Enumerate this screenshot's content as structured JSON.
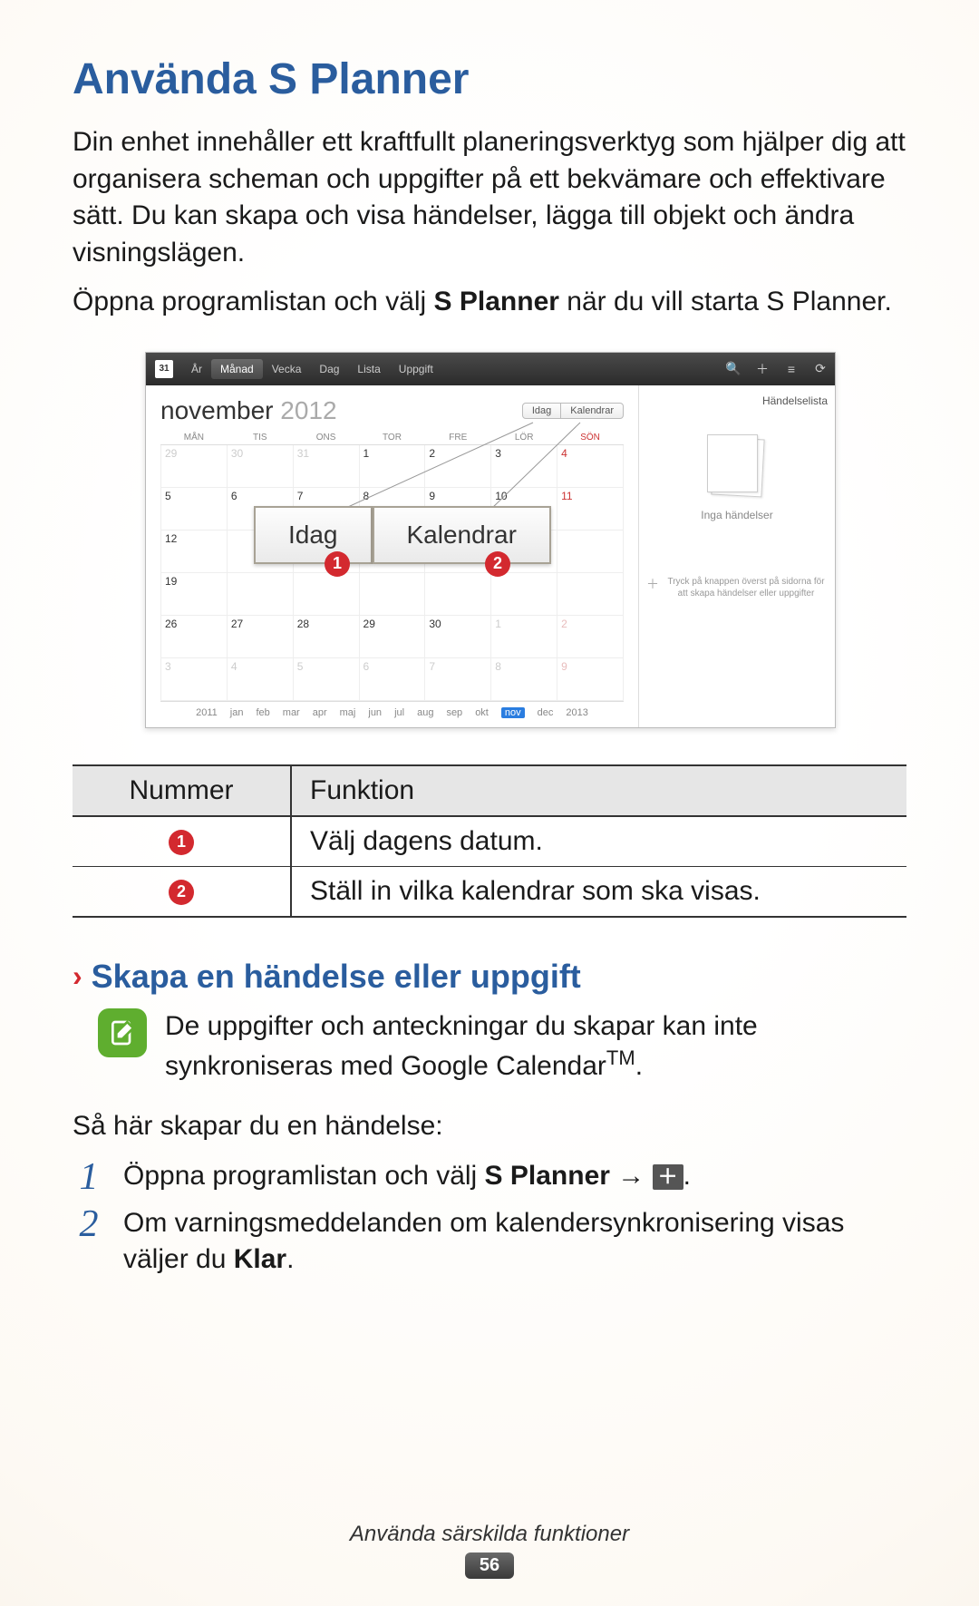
{
  "title": "Använda S Planner",
  "intro1": "Din enhet innehåller ett kraftfullt planeringsverktyg som hjälper dig att organisera scheman och uppgifter på ett bekvämare och effektivare sätt. Du kan skapa och visa händelser, lägga till objekt och ändra visningslägen.",
  "intro2_pre": "Öppna programlistan och välj ",
  "intro2_bold": "S Planner",
  "intro2_post": " när du vill starta S Planner.",
  "screenshot": {
    "badge": "31",
    "tabs": {
      "year": "År",
      "month": "Månad",
      "week": "Vecka",
      "day": "Dag",
      "list": "Lista",
      "task": "Uppgift"
    },
    "month_label": "november",
    "year_label": "2012",
    "pills": {
      "today": "Idag",
      "calendars": "Kalendrar"
    },
    "side": {
      "title": "Händelselista",
      "no_events": "Inga händelser",
      "hint": "Tryck på knappen överst på sidorna för att skapa händelser eller uppgifter"
    },
    "weekdays": [
      "MÅN",
      "TIS",
      "ONS",
      "TOR",
      "FRE",
      "LÖR",
      "SÖN"
    ],
    "rows": [
      [
        "29",
        "30",
        "31",
        "1",
        "2",
        "3",
        "4"
      ],
      [
        "5",
        "6",
        "7",
        "8",
        "9",
        "10",
        "11"
      ],
      [
        "12",
        "",
        "",
        "",
        "",
        "",
        ""
      ],
      [
        "19",
        "",
        "",
        "",
        "",
        "",
        ""
      ],
      [
        "26",
        "27",
        "28",
        "29",
        "30",
        "1",
        "2"
      ],
      [
        "3",
        "4",
        "5",
        "6",
        "7",
        "8",
        "9"
      ]
    ],
    "yearstrip": [
      "2011",
      "jan",
      "feb",
      "mar",
      "apr",
      "maj",
      "jun",
      "jul",
      "aug",
      "sep",
      "okt",
      "nov",
      "dec",
      "2013"
    ],
    "yearstrip_active": "nov",
    "callout": {
      "today": "Idag",
      "calendars": "Kalendrar",
      "n1": "1",
      "n2": "2"
    }
  },
  "table": {
    "head": {
      "num": "Nummer",
      "func": "Funktion"
    },
    "rows": [
      {
        "n": "1",
        "f": "Välj dagens datum."
      },
      {
        "n": "2",
        "f": "Ställ in vilka kalendrar som ska visas."
      }
    ]
  },
  "sub": {
    "heading": "Skapa en händelse eller uppgift",
    "note_a": "De uppgifter och anteckningar du skapar kan inte synkroniseras med Google Calendar",
    "note_tm": "TM",
    "note_b": ".",
    "howto": "Så här skapar du en händelse:",
    "step1_pre": "Öppna programlistan och välj ",
    "step1_bold": "S Planner",
    "step1_arrow": " → ",
    "step1_post": ".",
    "step2_pre": "Om varningsmeddelanden om kalendersynkronisering visas väljer du ",
    "step2_bold": "Klar",
    "step2_post": "."
  },
  "footer": {
    "category": "Använda särskilda funktioner",
    "page": "56"
  }
}
